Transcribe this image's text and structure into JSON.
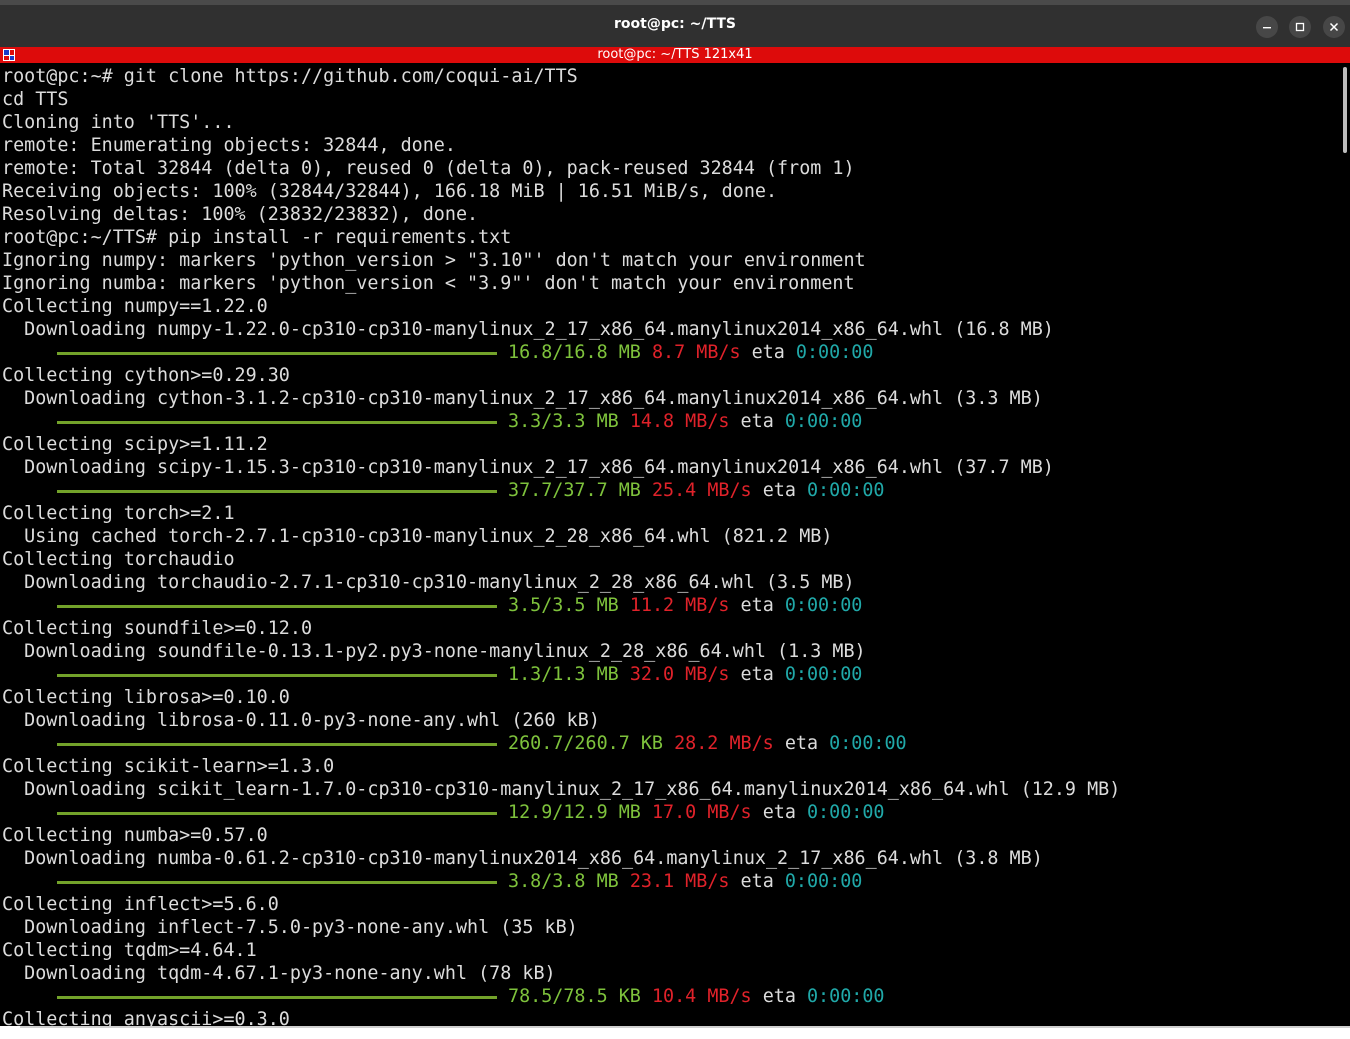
{
  "window": {
    "title": "root@pc: ~/TTS",
    "controls": [
      "minimize",
      "maximize",
      "close"
    ]
  },
  "tmux": {
    "title": "root@pc: ~/TTS 121x41"
  },
  "colors": {
    "progress": "#73a22a",
    "size_text": "#7ec23c",
    "rate_text": "#e0222a",
    "eta_text": "#20a8a8",
    "tmux_bar": "#dd0b0b"
  },
  "terminal": {
    "lines": [
      {
        "t": "text",
        "text": "root@pc:~# git clone https://github.com/coqui-ai/TTS"
      },
      {
        "t": "text",
        "text": "cd TTS"
      },
      {
        "t": "text",
        "text": "Cloning into 'TTS'..."
      },
      {
        "t": "text",
        "text": "remote: Enumerating objects: 32844, done."
      },
      {
        "t": "text",
        "text": "remote: Total 32844 (delta 0), reused 0 (delta 0), pack-reused 32844 (from 1)"
      },
      {
        "t": "text",
        "text": "Receiving objects: 100% (32844/32844), 166.18 MiB | 16.51 MiB/s, done."
      },
      {
        "t": "text",
        "text": "Resolving deltas: 100% (23832/23832), done."
      },
      {
        "t": "text",
        "text": "root@pc:~/TTS# pip install -r requirements.txt"
      },
      {
        "t": "text",
        "text": "Ignoring numpy: markers 'python_version > \"3.10\"' don't match your environment"
      },
      {
        "t": "text",
        "text": "Ignoring numba: markers 'python_version < \"3.9\"' don't match your environment"
      },
      {
        "t": "text",
        "text": "Collecting numpy==1.22.0"
      },
      {
        "t": "text",
        "text": "  Downloading numpy-1.22.0-cp310-cp310-manylinux_2_17_x86_64.manylinux2014_x86_64.whl (16.8 MB)"
      },
      {
        "t": "progress",
        "fraction": 1.0,
        "size": "16.8/16.8 MB",
        "rate": "8.7 MB/s",
        "eta_label": "eta",
        "eta": "0:00:00"
      },
      {
        "t": "text",
        "text": "Collecting cython>=0.29.30"
      },
      {
        "t": "text",
        "text": "  Downloading cython-3.1.2-cp310-cp310-manylinux_2_17_x86_64.manylinux2014_x86_64.whl (3.3 MB)"
      },
      {
        "t": "progress",
        "fraction": 1.0,
        "size": "3.3/3.3 MB",
        "rate": "14.8 MB/s",
        "eta_label": "eta",
        "eta": "0:00:00"
      },
      {
        "t": "text",
        "text": "Collecting scipy>=1.11.2"
      },
      {
        "t": "text",
        "text": "  Downloading scipy-1.15.3-cp310-cp310-manylinux_2_17_x86_64.manylinux2014_x86_64.whl (37.7 MB)"
      },
      {
        "t": "progress",
        "fraction": 1.0,
        "size": "37.7/37.7 MB",
        "rate": "25.4 MB/s",
        "eta_label": "eta",
        "eta": "0:00:00"
      },
      {
        "t": "text",
        "text": "Collecting torch>=2.1"
      },
      {
        "t": "text",
        "text": "  Using cached torch-2.7.1-cp310-cp310-manylinux_2_28_x86_64.whl (821.2 MB)"
      },
      {
        "t": "text",
        "text": "Collecting torchaudio"
      },
      {
        "t": "text",
        "text": "  Downloading torchaudio-2.7.1-cp310-cp310-manylinux_2_28_x86_64.whl (3.5 MB)"
      },
      {
        "t": "progress",
        "fraction": 1.0,
        "size": "3.5/3.5 MB",
        "rate": "11.2 MB/s",
        "eta_label": "eta",
        "eta": "0:00:00"
      },
      {
        "t": "text",
        "text": "Collecting soundfile>=0.12.0"
      },
      {
        "t": "text",
        "text": "  Downloading soundfile-0.13.1-py2.py3-none-manylinux_2_28_x86_64.whl (1.3 MB)"
      },
      {
        "t": "progress",
        "fraction": 1.0,
        "size": "1.3/1.3 MB",
        "rate": "32.0 MB/s",
        "eta_label": "eta",
        "eta": "0:00:00"
      },
      {
        "t": "text",
        "text": "Collecting librosa>=0.10.0"
      },
      {
        "t": "text",
        "text": "  Downloading librosa-0.11.0-py3-none-any.whl (260 kB)"
      },
      {
        "t": "progress",
        "fraction": 1.0,
        "size": "260.7/260.7 KB",
        "rate": "28.2 MB/s",
        "eta_label": "eta",
        "eta": "0:00:00"
      },
      {
        "t": "text",
        "text": "Collecting scikit-learn>=1.3.0"
      },
      {
        "t": "text",
        "text": "  Downloading scikit_learn-1.7.0-cp310-cp310-manylinux_2_17_x86_64.manylinux2014_x86_64.whl (12.9 MB)"
      },
      {
        "t": "progress",
        "fraction": 1.0,
        "size": "12.9/12.9 MB",
        "rate": "17.0 MB/s",
        "eta_label": "eta",
        "eta": "0:00:00"
      },
      {
        "t": "text",
        "text": "Collecting numba>=0.57.0"
      },
      {
        "t": "text",
        "text": "  Downloading numba-0.61.2-cp310-cp310-manylinux2014_x86_64.manylinux_2_17_x86_64.whl (3.8 MB)"
      },
      {
        "t": "progress",
        "fraction": 1.0,
        "size": "3.8/3.8 MB",
        "rate": "23.1 MB/s",
        "eta_label": "eta",
        "eta": "0:00:00"
      },
      {
        "t": "text",
        "text": "Collecting inflect>=5.6.0"
      },
      {
        "t": "text",
        "text": "  Downloading inflect-7.5.0-py3-none-any.whl (35 kB)"
      },
      {
        "t": "text",
        "text": "Collecting tqdm>=4.64.1"
      },
      {
        "t": "text",
        "text": "  Downloading tqdm-4.67.1-py3-none-any.whl (78 kB)"
      },
      {
        "t": "progress",
        "fraction": 1.0,
        "size": "78.5/78.5 KB",
        "rate": "10.4 MB/s",
        "eta_label": "eta",
        "eta": "0:00:00"
      },
      {
        "t": "text",
        "text": "Collecting anyascii>=0.3.0"
      }
    ]
  }
}
